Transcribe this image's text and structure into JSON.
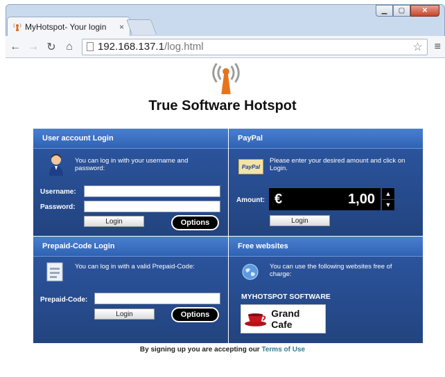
{
  "browser": {
    "tab_title": "MyHotspot- Your login",
    "url_host": "192.168.137.1",
    "url_path": "/log.html"
  },
  "page": {
    "title": "True Software Hotspot"
  },
  "user_login": {
    "header": "User account Login",
    "info": "You can log in with  your username  and password:",
    "username_label": "Username:",
    "password_label": "Password:",
    "login_button": "Login",
    "options_button": "Options"
  },
  "paypal": {
    "header": "PayPal",
    "logo_text": "PayPal",
    "info": "Please enter your desired amount and click on Login.",
    "amount_label": "Amount:",
    "currency": "€",
    "amount_value": "1,00",
    "login_button": "Login"
  },
  "prepaid": {
    "header": "Prepaid-Code Login",
    "info": "You can log in with a valid Prepaid-Code:",
    "code_label": "Prepaid-Code:",
    "login_button": "Login",
    "options_button": "Options"
  },
  "free_websites": {
    "header": "Free websites",
    "info": "You can use the  following websites  free of charge:",
    "sponsor_title": "MYHOTSPOT SOFTWARE",
    "sponsor_name": "Grand Cafe"
  },
  "footer": {
    "text": "By signing up you are accepting our ",
    "link": "Terms of Use"
  }
}
